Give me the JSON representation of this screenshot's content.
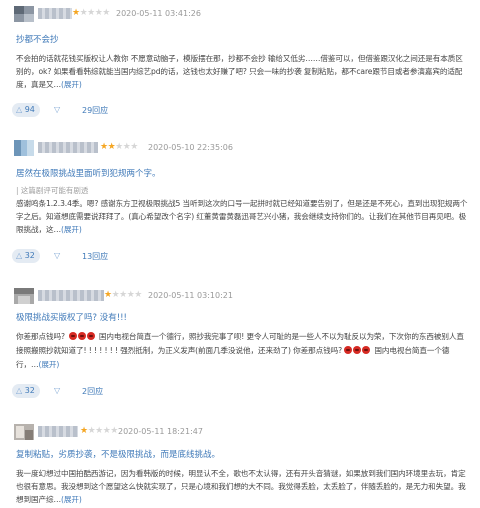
{
  "reviews": [
    {
      "rating": 1,
      "date": "2020-05-11 03:41:26",
      "title": "抄都不会抄",
      "note": "",
      "lead": "",
      "body": "不会拍的话就花钱买版权让人教你 不愿意动脑子，模版摆在那，抄都不会抄 输给又低劣……借鉴可以，但借鉴跟汉化之间还是有本质区别的，ok? 如果看看韩综就能当国内综艺pd的话，这钱也太好赚了吧? 只会一味的抄袭 复制粘贴，都不care跟节目或者参演嘉宾的适配度，真是又…",
      "more": "(展开)",
      "up": "94",
      "count": "29回应"
    },
    {
      "rating": 2,
      "date": "2020-05-10 22:35:06",
      "title": "居然在极限挑战里面听到犯规两个字。",
      "note": "| 这篇剧评可能有剧透",
      "lead": "",
      "body": "感谢鸣条1.2.3.4季。嗯? 感谢东方卫视极限挑战5 当听到这次的口号一起拼时就已经知道要告别了，但是还是不死心，直到出现犯规两个字之后。知道想底需要说拜拜了。(真心希望改个名字) 红董黄雷黄磊迅哥艺兴小猪，我会继续支持你们的。让我们在其他节目再见吧。极限挑战，这…",
      "more": "(展开)",
      "up": "32",
      "count": "13回应"
    },
    {
      "rating": 1,
      "date": "2020-05-11 03:10:21",
      "title": "极限挑战买版权了吗? 没有!!!",
      "note": "",
      "lead": "你差那点钱吗?",
      "emoji_count": 3,
      "body": "国内电视台简直一个德行，照抄我完事了呗! 更令人可耻的是一些人不以为耻反以为荣，下次你的东西被别人直接照搬照抄就知道了! ! ! ! ! ! ! 强烈抵制，为正义发声(前面几季没说他，还来劲了) 你差那点钱吗?",
      "tail_emoji_count": 3,
      "tail": "国内电视台简直一个德行，…",
      "more": "(展开)",
      "up": "32",
      "count": "2回应"
    },
    {
      "rating": 1,
      "date": "2020-05-11 18:21:47",
      "title": "复制粘贴，劣质抄袭，不是极限挑战，而是底线挑战。",
      "note": "",
      "lead": "",
      "body": "我一度幻想过中国拍酷西游记，因为看韩版的时候，明显认不全，歌也不太认得，还有开头音猜谜，如果放到我们国内环境里去玩，肯定也很有意思。我没想到这个愿望这么快就实现了，只是心境和我们想的大不同。我觉得丢脸，太丢脸了，伴随丢脸的，是无力和失望。我想到国产综…",
      "more": "(展开)",
      "up": "",
      "count": ""
    }
  ],
  "icons": {
    "up": "arrow-up-icon",
    "down": "arrow-down-icon",
    "star": "star-icon",
    "emoji": "angry-face-icon"
  },
  "colors": {
    "link": "#3f79b8",
    "star": "#f5a623",
    "star_off": "#d6d6d6",
    "date": "#999999",
    "emoji": "#d62a23"
  }
}
